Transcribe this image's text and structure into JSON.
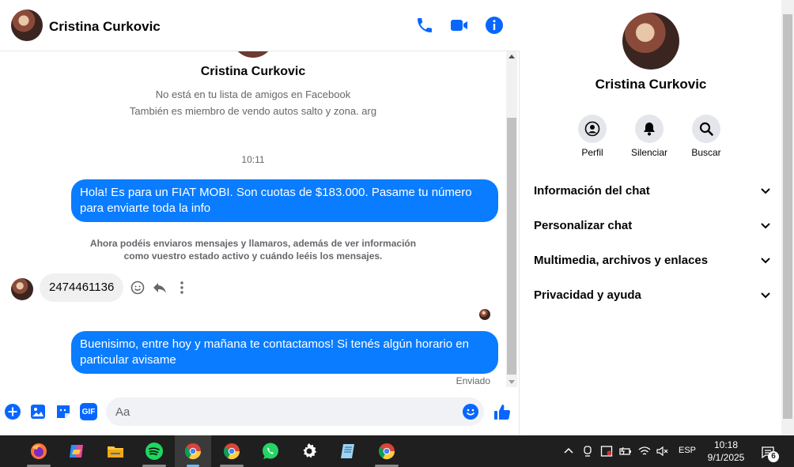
{
  "header": {
    "contact_name": "Cristina Curkovic",
    "actions": [
      "phone-icon",
      "video-icon",
      "info-icon"
    ]
  },
  "conversation": {
    "profile_name": "Cristina Curkovic",
    "profile_line_1": "No está en tu lista de amigos en Facebook",
    "profile_line_2": "También es miembro de vendo autos salto y zona. arg",
    "timestamp": "10:11",
    "message_1": "Hola! Es para un FIAT MOBI. Son cuotas de $183.000. Pasame tu número para enviarte toda la info",
    "notice": "Ahora podéis enviaros mensajes y llamaros, además de ver información como vuestro estado activo y cuándo leéis los mensajes.",
    "incoming_message": "2474461136",
    "message_2": "Buenisimo, entre hoy y mañana te contactamos! Si tenés algún horario en particular avisame",
    "sent_status": "Enviado"
  },
  "composer": {
    "placeholder": "Aa",
    "tools": [
      "plus-icon",
      "image-icon",
      "sticker-icon",
      "gif-icon"
    ],
    "gif_label": "GIF"
  },
  "panel": {
    "name": "Cristina Curkovic",
    "actions": [
      {
        "label": "Perfil",
        "icon": "profile-icon"
      },
      {
        "label": "Silenciar",
        "icon": "bell-icon"
      },
      {
        "label": "Buscar",
        "icon": "search-icon"
      }
    ],
    "sections": [
      {
        "label": "Información del chat"
      },
      {
        "label": "Personalizar chat"
      },
      {
        "label": "Multimedia, archivos y enlaces"
      },
      {
        "label": "Privacidad y ayuda"
      }
    ]
  },
  "taskbar": {
    "language": "ESP",
    "time": "10:18",
    "date": "9/1/2025",
    "notification_count": "6"
  },
  "colors": {
    "accent": "#0a7cff",
    "icon_blue": "#0866ff",
    "taskbar": "#1f1f1f"
  }
}
